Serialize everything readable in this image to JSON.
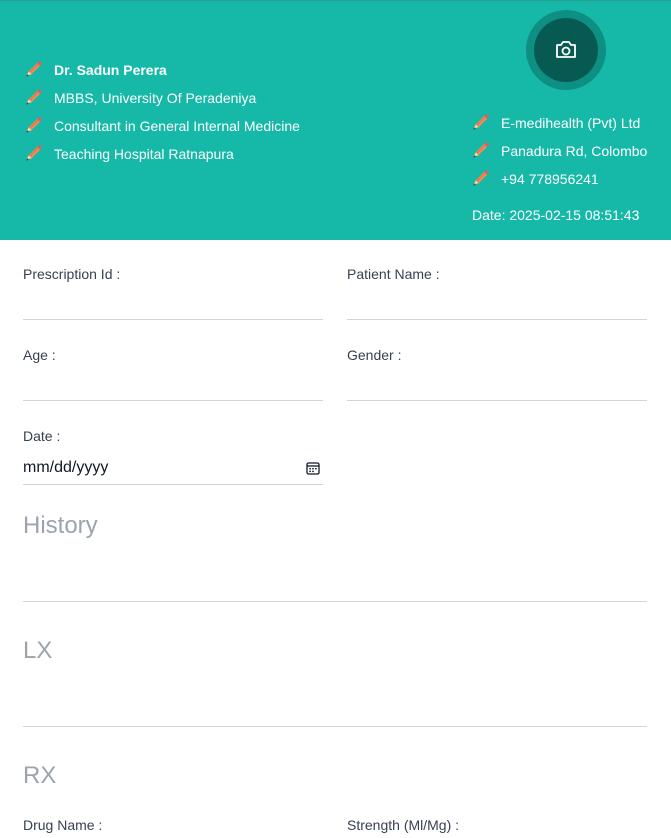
{
  "header": {
    "doctor": [
      {
        "text": "Dr. Sadun Perera"
      },
      {
        "text": "MBBS, University Of Peradeniya"
      },
      {
        "text": "Consultant in General Internal Medicine"
      },
      {
        "text": "Teaching Hospital Ratnapura"
      }
    ],
    "contact": [
      {
        "text": "E-medihealth (Pvt) Ltd"
      },
      {
        "text": "Panadura Rd, Colombo"
      },
      {
        "text": "+94 778956241"
      }
    ],
    "date_line": "Date: 2025-02-15 08:51:43",
    "avatar_icon": "camera-icon",
    "row_icon": "pencil-icon",
    "colors": {
      "header_bg": "#16b8a8",
      "avatar_outer": "#0e8f83",
      "avatar_inner": "#075a52"
    }
  },
  "form": {
    "prescription_id_label": "Prescription Id :",
    "prescription_id_value": "",
    "patient_name_label": "Patient Name :",
    "patient_name_value": "",
    "age_label": "Age :",
    "age_value": "",
    "gender_label": "Gender :",
    "gender_value": "",
    "date_label": "Date :",
    "date_placeholder": "mm/dd/yyyy",
    "history_label": "History",
    "lx_label": "LX",
    "rx_label": "RX",
    "drug_name_label": "Drug Name :",
    "strength_label": "Strength (Ml/Mg) :"
  }
}
